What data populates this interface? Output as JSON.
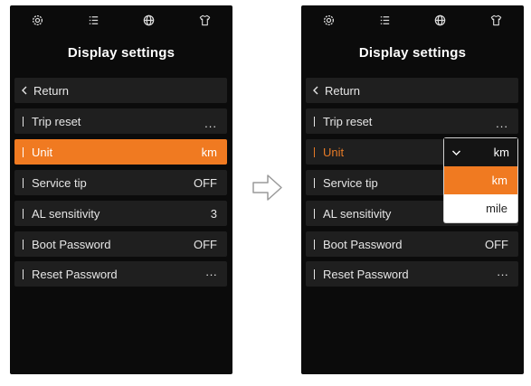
{
  "left_screen": {
    "title": "Display settings",
    "top_icons": [
      "gear-icon",
      "list-icon",
      "globe-icon",
      "shirt-icon"
    ],
    "rows": [
      {
        "label": "Return",
        "value": ""
      },
      {
        "label": "Trip reset",
        "value": "..."
      },
      {
        "label": "Unit",
        "value": "km"
      },
      {
        "label": "Service tip",
        "value": "OFF"
      },
      {
        "label": "AL sensitivity",
        "value": "3"
      },
      {
        "label": "Boot Password",
        "value": "OFF"
      },
      {
        "label": "Reset Password",
        "value": "···"
      }
    ]
  },
  "right_screen": {
    "title": "Display settings",
    "top_icons": [
      "gear-icon",
      "list-icon",
      "globe-icon",
      "shirt-icon"
    ],
    "rows": [
      {
        "label": "Return",
        "value": ""
      },
      {
        "label": "Trip reset",
        "value": "..."
      },
      {
        "label": "Unit",
        "value": ""
      },
      {
        "label": "Service tip",
        "value": ""
      },
      {
        "label": "AL sensitivity",
        "value": ""
      },
      {
        "label": "Boot Password",
        "value": "OFF"
      },
      {
        "label": "Reset Password",
        "value": "···"
      }
    ],
    "unit_dropdown": {
      "current": "km",
      "options": [
        "km",
        "mile"
      ],
      "selected": "km"
    }
  },
  "colors": {
    "accent": "#f07a21",
    "screen_bg": "#0b0b0b",
    "row_bg": "#1f1f1f"
  },
  "transition_arrow": "right-arrow-icon"
}
